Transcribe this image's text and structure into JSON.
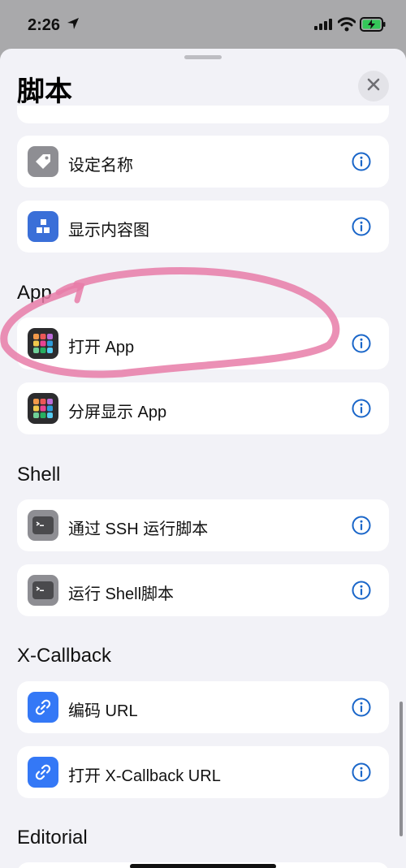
{
  "status_bar": {
    "time": "2:26"
  },
  "sheet": {
    "title": "脚本"
  },
  "sections": {
    "app": "App",
    "shell": "Shell",
    "xcallback": "X-Callback",
    "editorial": "Editorial"
  },
  "actions": [
    {
      "label": "设定名称",
      "icon": "tag-icon",
      "color": "#8e8e93"
    },
    {
      "label": "显示内容图",
      "icon": "content-graph-icon",
      "color": "#3a6fd8"
    },
    {
      "label": "打开 App",
      "icon": "app-grid-icon",
      "color": "#2c2c2e"
    },
    {
      "label": "分屏显示 App",
      "icon": "app-grid-icon",
      "color": "#2c2c2e"
    },
    {
      "label": "通过 SSH 运行脚本",
      "icon": "terminal-icon",
      "color": "#8e8e93"
    },
    {
      "label": "运行 Shell脚本",
      "icon": "terminal-icon",
      "color": "#8e8e93"
    },
    {
      "label": "编码 URL",
      "icon": "link-icon",
      "color": "#3478f6"
    },
    {
      "label": "打开 X-Callback URL",
      "icon": "link-icon",
      "color": "#3478f6"
    }
  ],
  "colors": {
    "accent": "#1a66c9",
    "annotation": "#e87ca8",
    "sheet_background": "#f2f2f7",
    "dimmed_background": "#a9a9ab"
  }
}
